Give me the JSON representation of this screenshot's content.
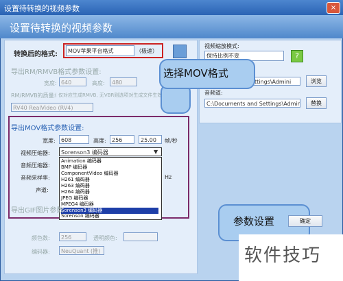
{
  "window": {
    "title": "设置待转换的视频参数",
    "close": "×"
  },
  "header": {
    "title": "设置待转换的视频参数"
  },
  "format": {
    "label": "转换后的格式:",
    "value": "MOV苹果平台格式",
    "badge": "（极速）"
  },
  "rm_section": {
    "title": "导出RM/RMVB格式参数设置:",
    "width_label": "宽度:",
    "width": "640",
    "height_label": "高度:",
    "height": "480",
    "quality_label": "RM/RMVB的质量:",
    "quality_hint": "( 仅对应生成RMVB, 无VBR则选项对生成文件生效 )",
    "codec": "RV40 RealVideo (RV4)"
  },
  "mov_section": {
    "title": "导出MOV格式参数设置:",
    "width_label": "宽度:",
    "width": "608",
    "height_label": "高度:",
    "height": "256",
    "fps": "25.00",
    "fps_unit": "帧/秒",
    "video_codec_label": "视频压缩器:",
    "video_codec": "Sorenson3 编码器",
    "audio_codec_label": "音频压缩器:",
    "sample_rate_label": "音频采样率:",
    "sample_unit": "Hz",
    "channels_label": "声道:"
  },
  "codec_list": [
    "Animation 编码器",
    "BMP 编码器",
    "ComponentVideo 编码器",
    "H261 编码器",
    "H263 编码器",
    "H264 编码器",
    "JPEG 编码器",
    "MPEG4 编码器",
    "Sorenson3 编码器",
    "Sorenson 编码器"
  ],
  "gif_section": {
    "title": "导出GIF图片参数",
    "color_label": "颜色数:",
    "color": "256",
    "transparent_label": "透明颜色:",
    "encoder_label": "编码器:",
    "encoder": "NeuQuant (推)"
  },
  "right_panel": {
    "aspect_label": "视频缩放模式:",
    "aspect": "保持比例不变",
    "settings_path": "ttings\\Admini",
    "browse": "浏览",
    "audio_label": "音频道:",
    "audio_path": "C:\\Documents and Settings\\Admini",
    "replace": "替换"
  },
  "callouts": {
    "mov": "选择MOV格式",
    "params": "参数设置",
    "confirm": "确定"
  },
  "watermark": "软件技巧"
}
